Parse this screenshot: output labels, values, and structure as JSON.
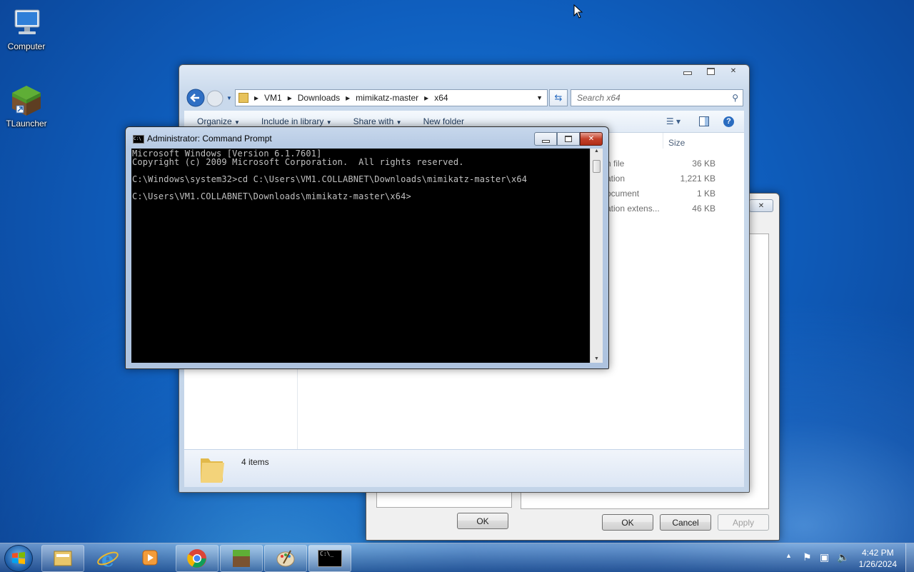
{
  "desktop": {
    "icons": [
      {
        "label": "Computer"
      },
      {
        "label": "TLauncher"
      }
    ]
  },
  "explorer": {
    "breadcrumb": [
      "VM1",
      "Downloads",
      "mimikatz-master",
      "x64"
    ],
    "search_placeholder": "Search x64",
    "toolbar": {
      "organize": "Organize",
      "include_in_library": "Include in library",
      "share_with": "Share with",
      "new_folder": "New folder"
    },
    "columns": {
      "size": "Size"
    },
    "rows": [
      {
        "type": "n file",
        "size": "36 KB"
      },
      {
        "type": "ation",
        "size": "1,221 KB"
      },
      {
        "type": "ocument",
        "size": "1 KB"
      },
      {
        "type": "ation extens...",
        "size": "46 KB"
      }
    ],
    "status": "4 items"
  },
  "props_dialog": {
    "ok_left": "OK",
    "ok": "OK",
    "cancel": "Cancel",
    "apply": "Apply"
  },
  "cmd": {
    "title": "Administrator: Command Prompt",
    "icon_text": "C:\\",
    "lines": [
      "Microsoft Windows [Version 6.1.7601]",
      "Copyright (c) 2009 Microsoft Corporation.  All rights reserved.",
      "",
      "C:\\Windows\\system32>cd C:\\Users\\VM1.COLLABNET\\Downloads\\mimikatz-master\\x64",
      "",
      "C:\\Users\\VM1.COLLABNET\\Downloads\\mimikatz-master\\x64>"
    ]
  },
  "taskbar": {
    "start_label": "Start",
    "pinned": [
      "Windows Explorer",
      "Internet Explorer",
      "Windows Media Player",
      "Google Chrome",
      "TLauncher",
      "Paint",
      "Command Prompt"
    ],
    "cmd_button_text": "C:\\_",
    "time": "4:42 PM",
    "date": "1/26/2024"
  },
  "colors": {
    "desktop": "#0f5fbf",
    "console_bg": "#000000",
    "console_fg": "#c0c0c0",
    "close_red": "#c4412b"
  }
}
